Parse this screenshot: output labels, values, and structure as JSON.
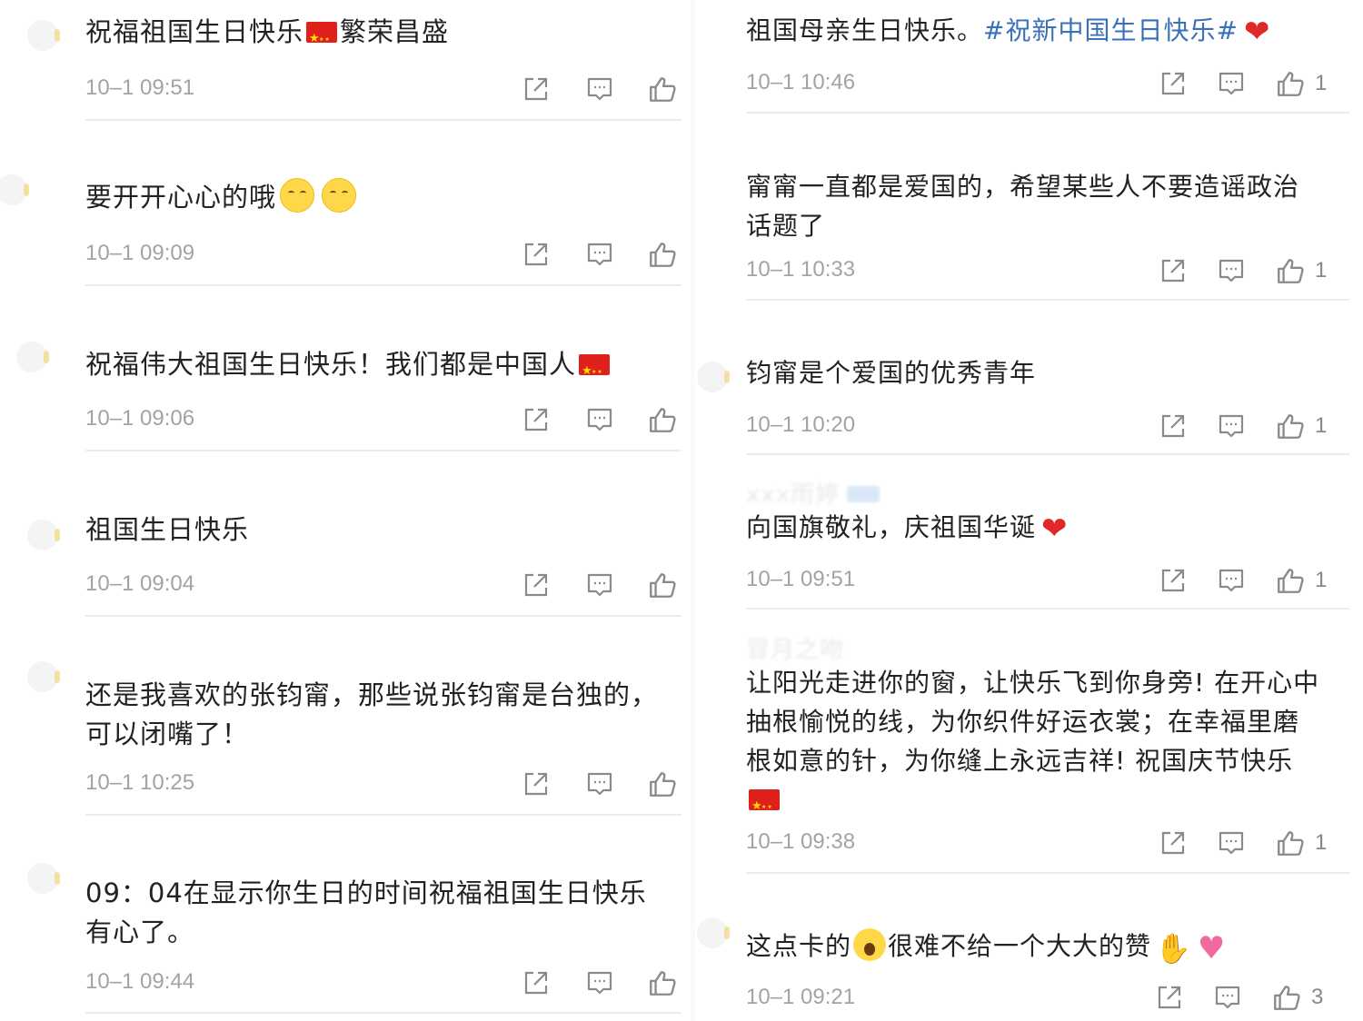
{
  "left_column": {
    "comments": [
      {
        "text": "祝福祖国生日快乐",
        "text_after": "繁荣昌盛",
        "time": "10–1 09:51",
        "inline": "flag-mid"
      },
      {
        "text": "要开开心心的哦",
        "time": "10–1 09:09",
        "inline": "kiss-emojis"
      },
      {
        "text": "祝福伟大祖国生日快乐！我们都是中国人",
        "time": "10–1 09:06",
        "inline": "flag-end"
      },
      {
        "text": "祖国生日快乐",
        "time": "10–1 09:04"
      },
      {
        "text_lines": [
          "还是我喜欢的张钧甯，那些说张钧甯是台独的，",
          "可以闭嘴了！"
        ],
        "time": "10–1 10:25"
      },
      {
        "text_lines": [
          "09：04在显示你生日的时间祝福祖国生日快乐",
          "有心了。"
        ],
        "time": "10–1 09:44"
      }
    ]
  },
  "right_column": {
    "comments": [
      {
        "text": "祖国母亲生日快乐。",
        "hashtag": "#祝新中国生日快乐#",
        "time": "10–1 10:46",
        "likes": "1"
      },
      {
        "text_lines": [
          "甯甯一直都是爱国的，希望某些人不要造谣政治",
          "话题了"
        ],
        "time": "10–1 10:33",
        "likes": "1"
      },
      {
        "text": "钧甯是个爱国的优秀青年",
        "time": "10–1 10:20",
        "likes": "1"
      },
      {
        "username": "xxx雨婷",
        "text": "向国旗敬礼，庆祖国华诞",
        "time": "10–1 09:51",
        "likes": "1"
      },
      {
        "username": "冒月之吻",
        "text_lines": [
          "让阳光走进你的窗，让快乐飞到你身旁! 在开心中",
          "抽根愉悦的线，为你织件好运衣裳；在幸福里磨",
          "根如意的针，为你缝上永远吉祥! 祝国庆节快乐"
        ],
        "time": "10–1 09:38",
        "likes": "1"
      },
      {
        "text_a": "这点卡的",
        "text_b": "很难不给一个大大的赞",
        "time": "10–1 09:21",
        "likes": "3"
      }
    ]
  },
  "icons": [
    "share-icon",
    "comment-icon",
    "like-icon"
  ],
  "colors": {
    "text": "#222222",
    "time": "#a3a3a3",
    "hashtag": "#3a70b8",
    "divider": "#ececec"
  }
}
